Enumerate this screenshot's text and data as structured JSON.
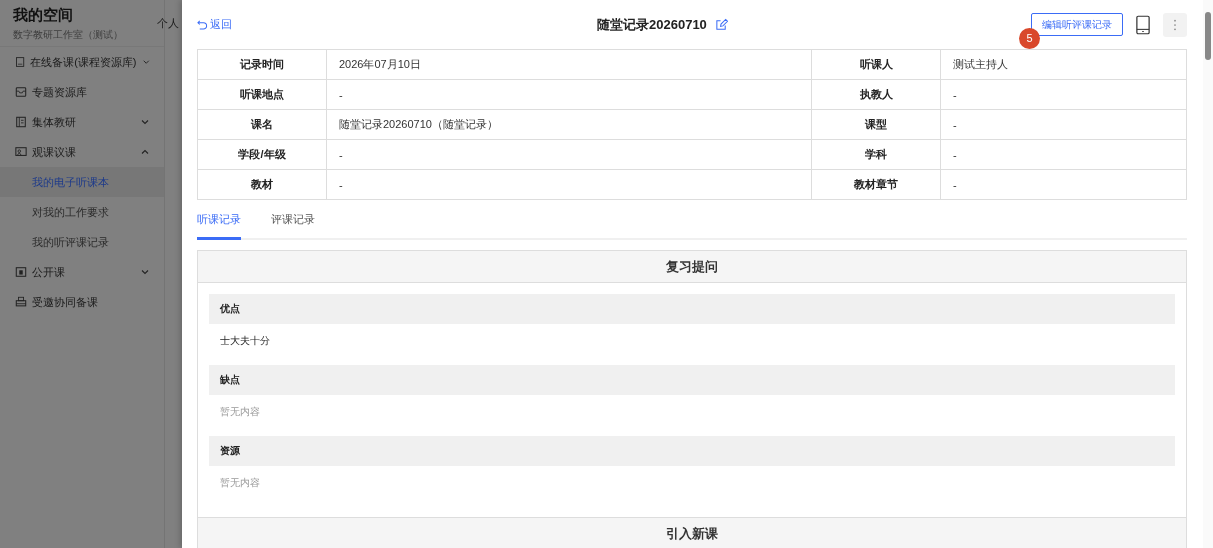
{
  "app": {
    "title": "我的空间",
    "subtitle": "数字教研工作室（测试）",
    "header_tab": "个人"
  },
  "sidebar": {
    "items": [
      {
        "label": "在线备课(课程资源库)",
        "expanded": false
      },
      {
        "label": "专题资源库"
      },
      {
        "label": "集体教研",
        "expanded": false
      },
      {
        "label": "观课议课",
        "expanded": true,
        "children": [
          {
            "label": "我的电子听课本",
            "selected": true
          },
          {
            "label": "对我的工作要求",
            "selected": false
          },
          {
            "label": "我的听评课记录",
            "selected": false
          }
        ]
      },
      {
        "label": "公开课",
        "expanded": false
      },
      {
        "label": "受邀协同备课"
      }
    ]
  },
  "drawer": {
    "back": "返回",
    "title": "随堂记录20260710",
    "edit_button": "编辑听评课记录",
    "badge": "5",
    "info": [
      [
        "记录时间",
        "2026年07月10日",
        "听课人",
        "测试主持人"
      ],
      [
        "听课地点",
        "-",
        "执教人",
        "-"
      ],
      [
        "课名",
        "随堂记录20260710（随堂记录）",
        "课型",
        "-"
      ],
      [
        "学段/年级",
        "-",
        "学科",
        "-"
      ],
      [
        "教材",
        "-",
        "教材章节",
        "-"
      ]
    ],
    "tabs": [
      {
        "label": "听课记录",
        "selected": true
      },
      {
        "label": "评课记录",
        "selected": false
      }
    ],
    "sections": [
      {
        "title": "复习提问",
        "fields": [
          {
            "label": "优点",
            "value": "士大夫十分",
            "empty": false
          },
          {
            "label": "缺点",
            "value": "暂无内容",
            "empty": true
          },
          {
            "label": "资源",
            "value": "暂无内容",
            "empty": true
          }
        ]
      },
      {
        "title": "引入新课"
      }
    ]
  }
}
